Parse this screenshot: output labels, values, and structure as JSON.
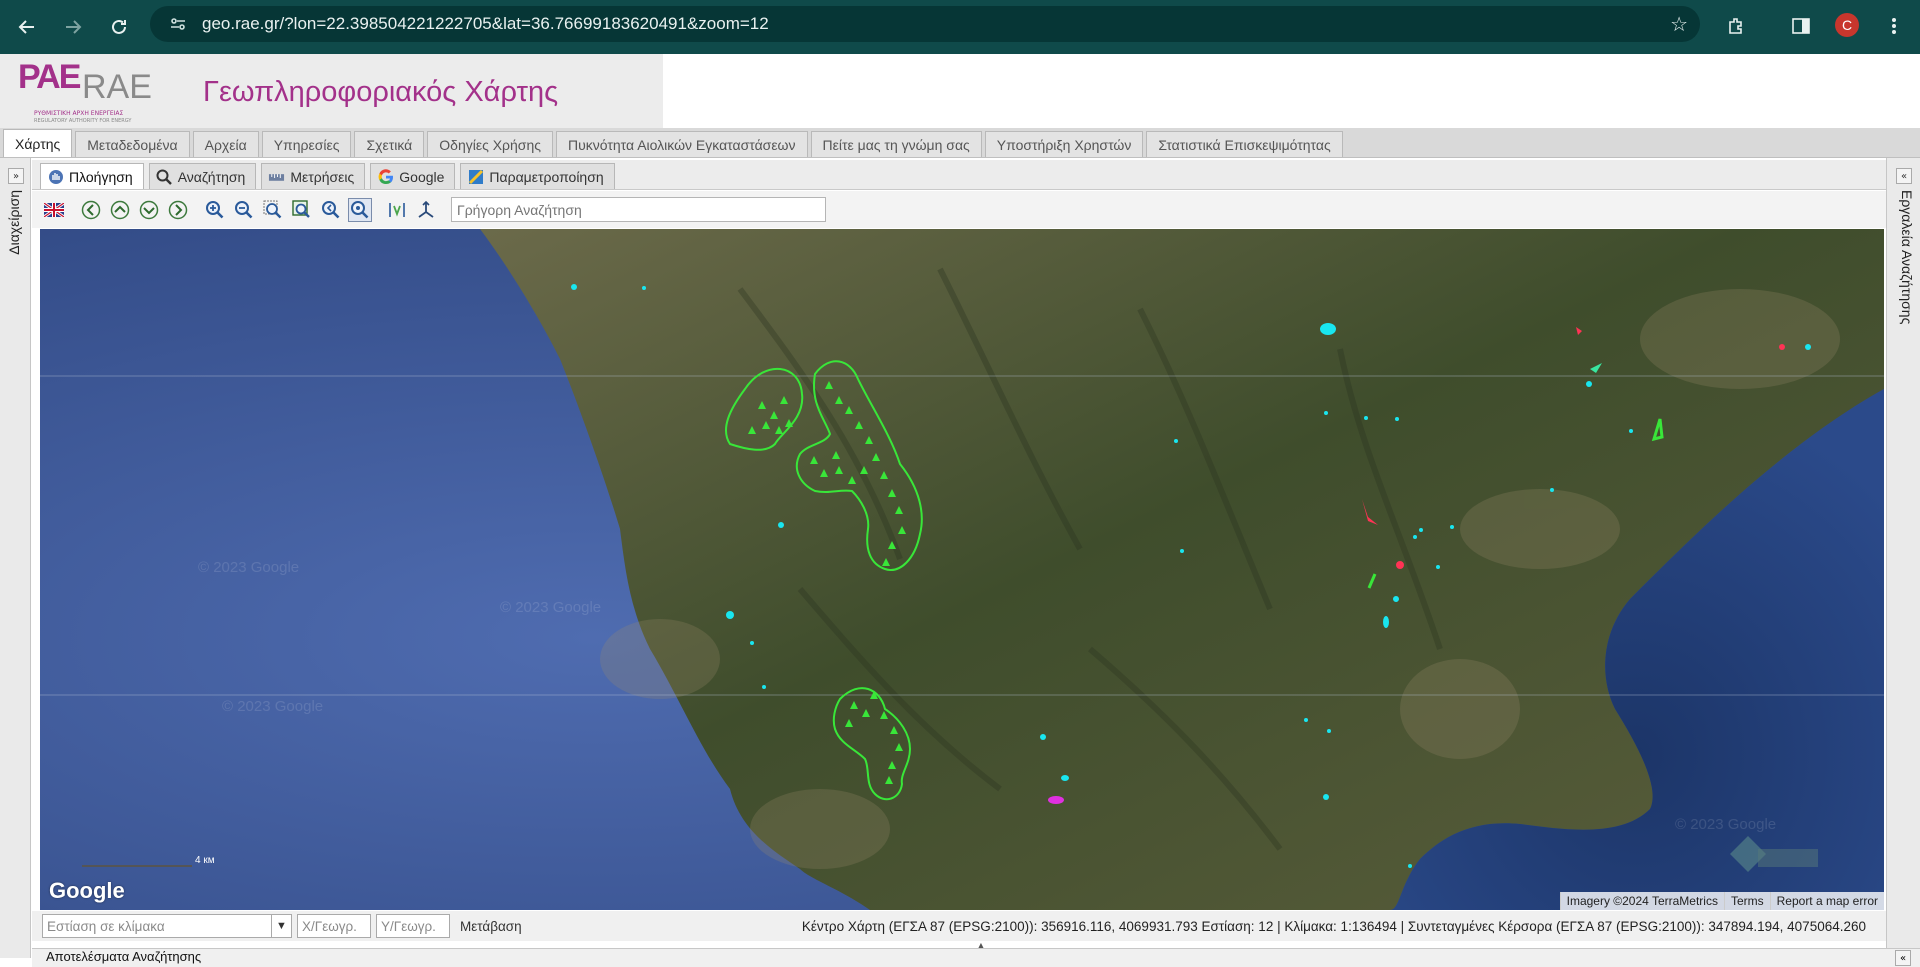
{
  "browser": {
    "url": "geo.rae.gr/?lon=22.398504221222705&lat=36.76699183620491&zoom=12",
    "profile_initial": "C"
  },
  "header": {
    "logo_pae": "PAE",
    "logo_rae": "RAE",
    "logo_subtitle_gr": "ΡΥΘΜΙΣΤΙΚΗ ΑΡΧΗ ΕΝΕΡΓΕΙΑΣ",
    "logo_subtitle_en": "REGULATORY AUTHORITY FOR ENERGY",
    "title": "Γεωπληροφοριακός Χάρτης"
  },
  "main_tabs": [
    {
      "label": "Χάρτης",
      "active": true
    },
    {
      "label": "Μεταδεδομένα"
    },
    {
      "label": "Αρχεία"
    },
    {
      "label": "Υπηρεσίες"
    },
    {
      "label": "Σχετικά"
    },
    {
      "label": "Οδηγίες Χρήσης"
    },
    {
      "label": "Πυκνότητα Αιολικών Εγκαταστάσεων"
    },
    {
      "label": "Πείτε μας τη γνώμη σας"
    },
    {
      "label": "Υποστήριξη Χρηστών"
    },
    {
      "label": "Στατιστικά Επισκεψιμότητας"
    }
  ],
  "side_panels": {
    "left_label": "Διαχείριση",
    "right_label": "Εργαλεία Αναζήτησης"
  },
  "sub_tabs": [
    {
      "label": "Πλοήγηση",
      "icon": "pan-hand-icon",
      "active": true
    },
    {
      "label": "Αναζήτηση",
      "icon": "magnifier-icon"
    },
    {
      "label": "Μετρήσεις",
      "icon": "ruler-icon"
    },
    {
      "label": "Google",
      "icon": "google-g-icon"
    },
    {
      "label": "Παραμετροποίηση",
      "icon": "settings-map-icon"
    }
  ],
  "toolbar": {
    "quick_search_placeholder": "Γρήγορη Αναζήτηση",
    "language_flag": "uk-flag-icon"
  },
  "map": {
    "watermark": "© 2023 Google",
    "google_logo": "Google",
    "scale_label": "4 км",
    "attribution": [
      "Imagery ©2024 TerraMetrics",
      "Terms",
      "Report a map error"
    ],
    "colors": {
      "sea": "#3d5a9a",
      "land": "#4f5a36",
      "wind_park_outline": "#39e639",
      "cyan_feature": "#19e6f0",
      "red_feature": "#ff3355",
      "magenta_feature": "#e030e0"
    }
  },
  "status": {
    "zoom_placeholder": "Εστίαση σε κλίμακα",
    "x_placeholder": "Χ/Γεωγρ.",
    "y_placeholder": "Υ/Γεωγρ.",
    "go_label": "Μετάβαση",
    "map_info": "Κέντρο Χάρτη (ΕΓΣΑ 87 (EPSG:2100)): 356916.116, 4069931.793 Εστίαση: 12 | Κλίμακα: 1:136494 | Συντεταγμένες Κέρσορα (ΕΓΣΑ 87 (EPSG:2100)): 347894.194, 4075064.260"
  },
  "results_panel": {
    "title": "Αποτελέσματα Αναζήτησης"
  }
}
